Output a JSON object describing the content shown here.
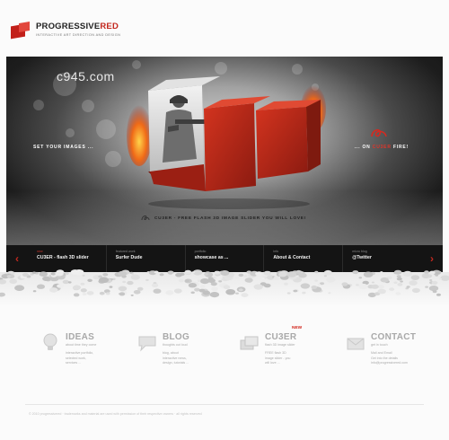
{
  "header": {
    "brand_part1": "PROGRESSIVE",
    "brand_part2": "RED",
    "tagline": "interactive art direction and design"
  },
  "hero": {
    "watermark": "c945.com",
    "left_text": "SET YOUR IMAGES ...",
    "right_text_prefix": "... ON",
    "right_text_accent": "CU3ER",
    "right_text_suffix": "FIRE!",
    "caption": "CU3ER - FREE FLASH 3D IMAGE SLIDER YOU WILL LOVE!"
  },
  "menu": {
    "prev_arrow": "‹",
    "next_arrow": "›",
    "items": [
      {
        "kicker": "new",
        "label": "CU3ER - flash 3D slider"
      },
      {
        "kicker": "featured work",
        "label": "Surfer Dude"
      },
      {
        "kicker": "portfolio",
        "label": "showcase as ..."
      },
      {
        "kicker": "info",
        "label": "About & Contact"
      },
      {
        "kicker": "micro blog",
        "label": "@Twitter"
      }
    ]
  },
  "features": [
    {
      "title": "IDEAS",
      "subtitle": "about time they come",
      "lines": [
        "interactive portfolio,",
        "selected work,",
        "services ..."
      ],
      "badge": ""
    },
    {
      "title": "BLOG",
      "subtitle": "thoughts out loud",
      "lines": [
        "blog, about",
        "interactive news,",
        "design, tutorials ..."
      ],
      "badge": ""
    },
    {
      "title": "CU3ER",
      "subtitle": "flash 3D image slider",
      "lines": [
        "FREE flash 3D",
        "image slider - you",
        "will love ..."
      ],
      "badge": "NEW"
    },
    {
      "title": "CONTACT",
      "subtitle": "get in touch",
      "lines": [
        "Mail and Email",
        "Get into the details",
        "info@progressivered.com"
      ],
      "badge": ""
    }
  ],
  "footer": {
    "text": "© 2010 progressivered  ·  trademarks and material are used with permission of their respective owners  ·  all rights reserved"
  },
  "colors": {
    "accent": "#c3271e",
    "menu_bg": "#141414",
    "feature_text": "#a9a9a9"
  }
}
